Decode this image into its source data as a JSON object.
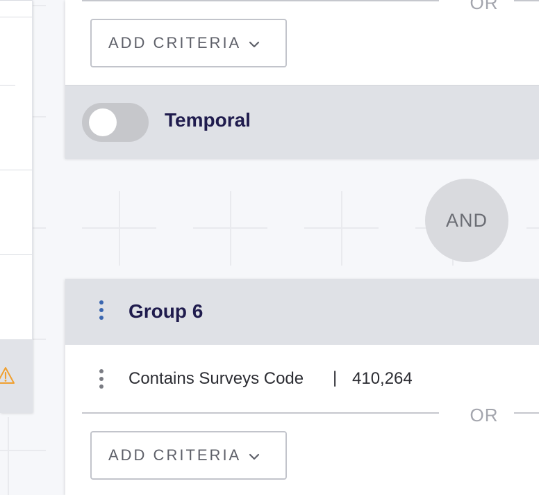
{
  "top_group": {
    "or_label": "OR",
    "add_criteria_label": "ADD CRITERIA",
    "add_criteria_icon": "chevron-down-icon"
  },
  "temporal": {
    "label": "Temporal",
    "enabled": false
  },
  "connector": {
    "label": "AND"
  },
  "group6": {
    "title": "Group 6",
    "criteria": [
      {
        "label": "Contains Surveys Code",
        "separator": "|",
        "count": "410,264"
      }
    ],
    "or_label": "OR",
    "add_criteria_label": "ADD CRITERIA"
  },
  "left_panel": {
    "warning_icon": "warning-icon",
    "warning_color": "#f0a030"
  },
  "colors": {
    "title": "#1f1b4d",
    "header_bg": "#dfe1e6",
    "kebab_accent": "#3a66b0"
  }
}
